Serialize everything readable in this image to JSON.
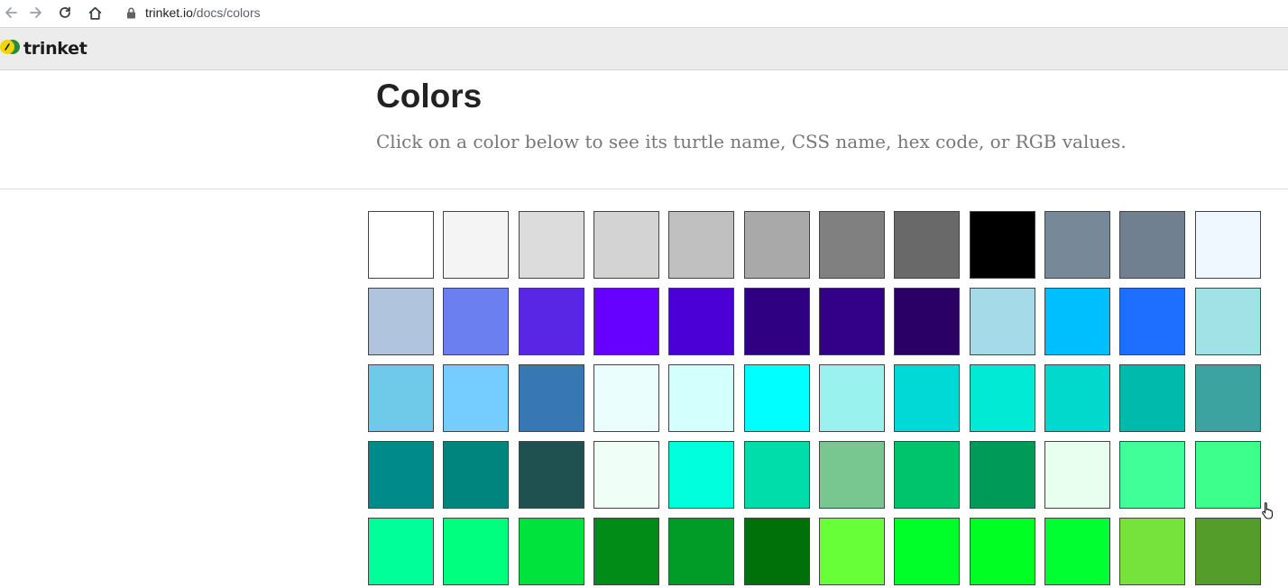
{
  "browser": {
    "url_host": "trinket.io",
    "url_path": "/docs/colors"
  },
  "header": {
    "logo_text": "trinket"
  },
  "main": {
    "title": "Colors",
    "subtitle": "Click on a color below to see its turtle name, CSS name, hex code, or RGB values."
  },
  "swatches": [
    "#ffffff",
    "#f4f4f4",
    "#dcdcdc",
    "#d3d3d3",
    "#c0c0c0",
    "#a9a9a9",
    "#808080",
    "#696969",
    "#000000",
    "#778899",
    "#708090",
    "#f0f8ff",
    "#b0c4de",
    "#6b7ff0",
    "#5a26e6",
    "#6600ff",
    "#4b00d6",
    "#2f0082",
    "#330088",
    "#2a0066",
    "#a5dae8",
    "#00bfff",
    "#1e6fff",
    "#a0e2e6",
    "#6ecae8",
    "#75cdff",
    "#3778b4",
    "#eafffd",
    "#d3fffc",
    "#00ffff",
    "#9af2ee",
    "#00d9d6",
    "#00ead6",
    "#00d9cc",
    "#00bbac",
    "#3ca3a0",
    "#008b8b",
    "#00847e",
    "#205151",
    "#effff8",
    "#00ffdd",
    "#00dcaa",
    "#78c690",
    "#00c46c",
    "#009a58",
    "#e8fff0",
    "#40ff98",
    "#3cff8c",
    "#00ff98",
    "#00ff7f",
    "#00e33c",
    "#008c16",
    "#009c28",
    "#007008",
    "#66ff38",
    "#00ff28",
    "#00ff22",
    "#00ff30",
    "#75e33c",
    "#559d2b"
  ]
}
